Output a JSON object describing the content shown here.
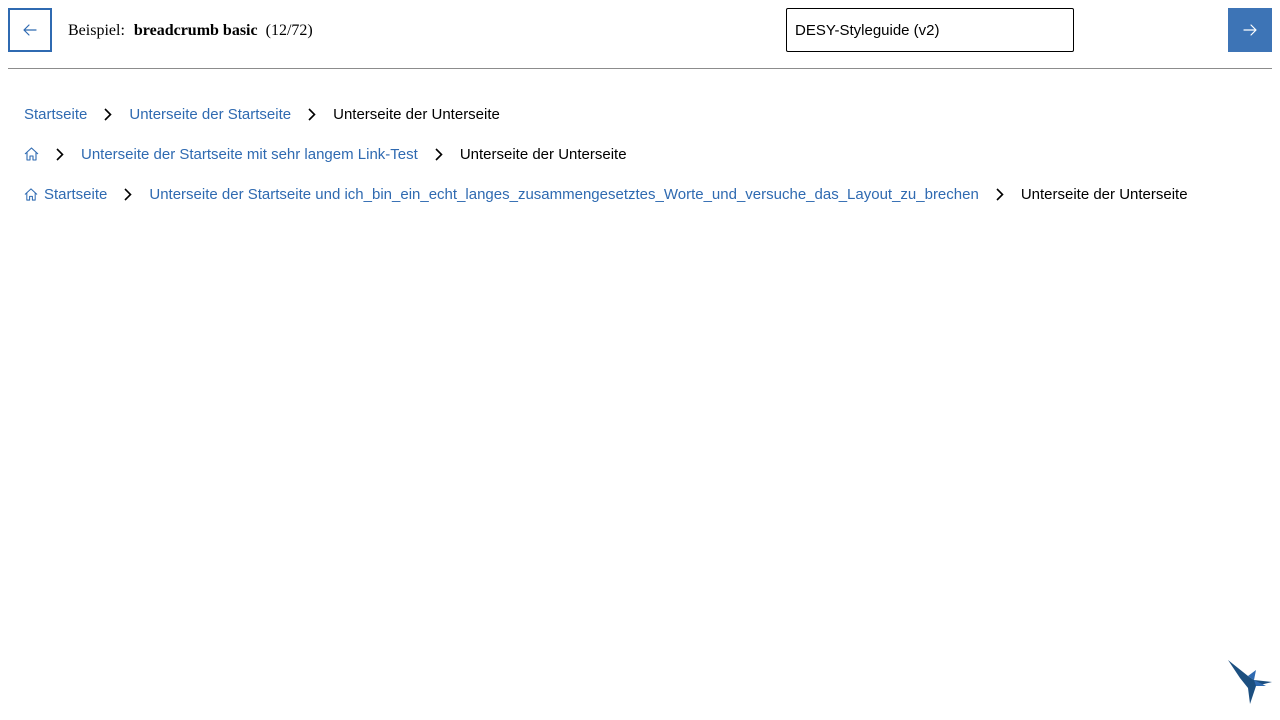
{
  "header": {
    "prev_label": "Zurück",
    "next_label": "Weiter",
    "example_prefix": "Beispiel:",
    "example_name": "breadcrumb basic",
    "example_count": "(12/72)",
    "guide_select_value": "DESY-Styleguide (v2)"
  },
  "breadcrumbs": [
    {
      "items": [
        "Startseite",
        "Unterseite der Startseite"
      ],
      "current": "Unterseite der Unterseite"
    },
    {
      "home_icon_only": true,
      "items": [
        "Unterseite der Startseite mit sehr langem Link-Test"
      ],
      "current": "Unterseite der Unterseite"
    },
    {
      "home_label": "Startseite",
      "items": [
        "Unterseite der Startseite und ich_bin_ein_echt_langes_zusammengesetztes_Worte_und_versuche_das_Layout_zu_brechen"
      ],
      "current": "Unterseite der Unterseite"
    }
  ],
  "colors": {
    "link": "#2f6ab1",
    "next_button": "#3d74b6",
    "logo": "#1c4f80"
  },
  "icons": {
    "prev": "arrow-left-icon",
    "next": "arrow-right-icon",
    "separator": "chevron-right-icon",
    "home": "home-icon",
    "logo": "bird-logo-icon"
  }
}
